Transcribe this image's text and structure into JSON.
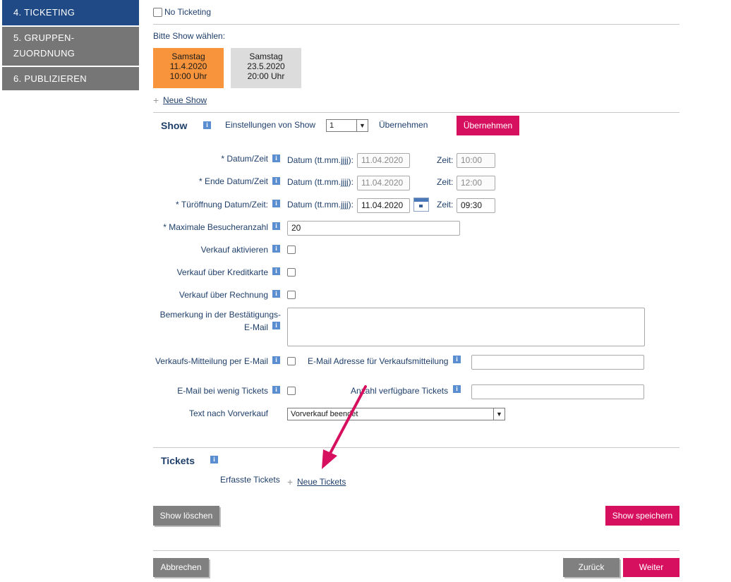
{
  "sidebar": {
    "items": [
      {
        "label": "4. TICKETING"
      },
      {
        "label_line1": "5. GRUPPEN-",
        "label_line2": "ZUORDNUNG"
      },
      {
        "label": "6. PUBLIZIEREN"
      }
    ]
  },
  "top": {
    "no_ticketing_label": "No Ticketing",
    "show_select_prompt": "Bitte Show wählen:"
  },
  "shows": [
    {
      "day": "Samstag",
      "date": "11.4.2020",
      "time": "10:00 Uhr",
      "active": true
    },
    {
      "day": "Samstag",
      "date": "23.5.2020",
      "time": "20:00 Uhr",
      "active": false
    }
  ],
  "new_show_link": "Neue Show",
  "show_section": {
    "title": "Show",
    "settings_label": "Einstellungen von Show",
    "settings_value": "1",
    "apply_text": "Übernehmen",
    "apply_button": "Übernehmen"
  },
  "form": {
    "datum_zeit_label": "* Datum/Zeit",
    "ende_datum_zeit_label": "* Ende Datum/Zeit",
    "tueroeffnung_label": "* Türöffnung Datum/Zeit:",
    "date_hint": "Datum (tt.mm.jjjj):",
    "time_hint": "Zeit:",
    "datum_value": "11.04.2020",
    "datum_time": "10:00",
    "ende_value": "11.04.2020",
    "ende_time": "12:00",
    "tuer_value": "11.04.2020",
    "tuer_time": "09:30",
    "max_besucher_label": "* Maximale Besucheranzahl",
    "max_besucher_value": "20",
    "verkauf_aktivieren_label": "Verkauf aktivieren",
    "verkauf_kreditkarte_label": "Verkauf über Kreditkarte",
    "verkauf_rechnung_label": "Verkauf über Rechnung",
    "bemerkung_label_line1": "Bemerkung in der Bestätigungs-",
    "bemerkung_label_line2": "E-Mail",
    "verkaufs_mitteilung_label": "Verkaufs-Mitteilung per E-Mail",
    "email_adresse_label": "E-Mail Adresse für Verkaufsmitteilung",
    "wenig_tickets_label": "E-Mail bei wenig Tickets",
    "anzahl_tickets_label": "Anzahl verfügbare Tickets",
    "text_nach_vorverkauf_label": "Text nach Vorverkauf",
    "text_nach_vorverkauf_value": "Vorverkauf beendet"
  },
  "tickets_section": {
    "title": "Tickets",
    "erfasste_label": "Erfasste Tickets",
    "new_tickets_link": "Neue Tickets"
  },
  "buttons": {
    "show_loeschen": "Show löschen",
    "show_speichern": "Show speichern",
    "abbrechen": "Abbrechen",
    "zurueck": "Zurück",
    "weiter": "Weiter"
  },
  "icons": {
    "info": "info-icon",
    "calendar": "calendar-icon",
    "plus": "plus-icon",
    "dropdown": "chevron-down-icon",
    "annotation_arrow": "arrow-annotation"
  },
  "colors": {
    "nav_active": "#1f4a86",
    "nav_inactive": "#767676",
    "tile_active": "#f7943c",
    "tile_inactive": "#dcdcdc",
    "primary_button": "#d6105e",
    "secondary_button": "#808080",
    "arrow": "#d6105e"
  }
}
